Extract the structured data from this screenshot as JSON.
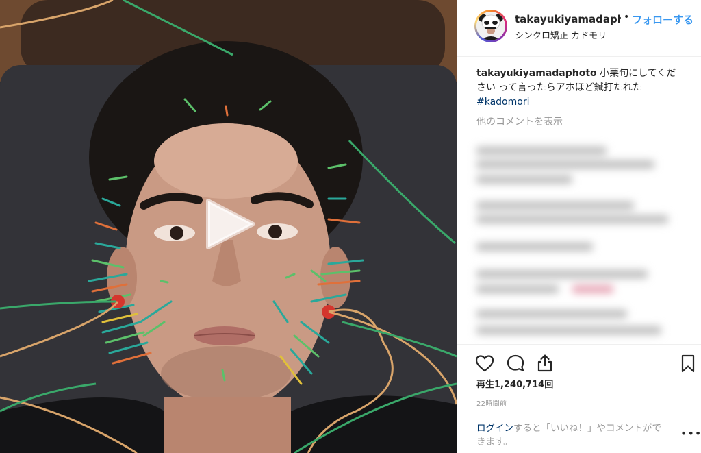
{
  "post": {
    "username": "takayukiyamadaph...",
    "follow_dot": "•",
    "follow_label": "フォローする",
    "location": "シンクロ矯正 カドモリ"
  },
  "caption": {
    "username": "takayukiyamadaphoto",
    "text": " 小栗旬にしてください って言ったらアホほど鍼打たれた",
    "hashtag": "#kadomori"
  },
  "comments": {
    "more_label": "他のコメントを表示"
  },
  "actions": {
    "like_icon": "heart-icon",
    "comment_icon": "comment-icon",
    "share_icon": "share-icon",
    "save_icon": "bookmark-icon"
  },
  "stats": {
    "views_label": "再生1,240,714回",
    "time_label": "22時間前"
  },
  "footer": {
    "login_link": "ログイン",
    "login_rest": "すると「いいね！」やコメントができます。",
    "more_options": "•••"
  },
  "media": {
    "type": "video",
    "play_icon": "play-icon"
  },
  "colors": {
    "accent": "#3897f0",
    "hashtag": "#003569",
    "muted": "#999999",
    "text": "#262626"
  }
}
